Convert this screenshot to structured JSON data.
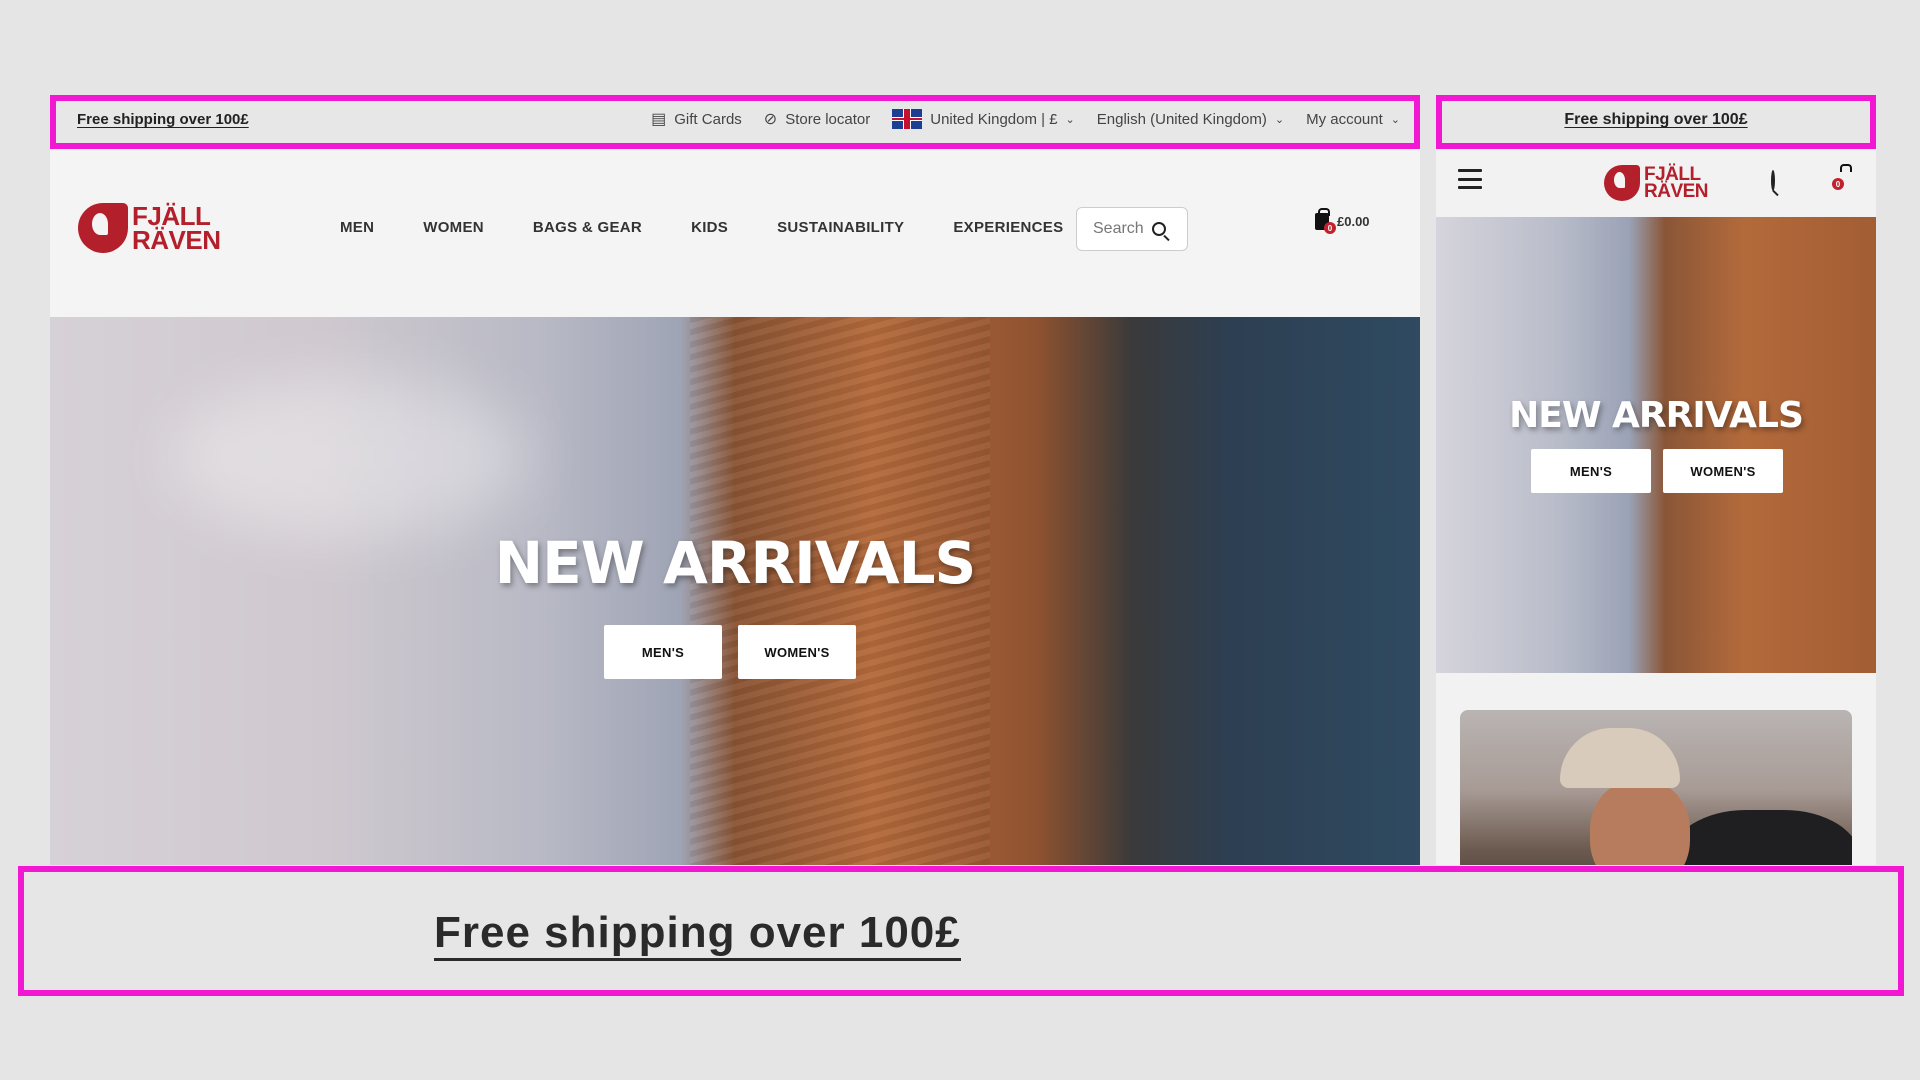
{
  "desktop": {
    "topbar": {
      "shipping": "Free shipping over 100£",
      "gift_cards": "Gift Cards",
      "store_locator": "Store locator",
      "country": "United Kingdom | £",
      "language": "English (United Kingdom)",
      "account": "My account"
    },
    "header": {
      "logo_line1": "FJÄLL",
      "logo_line2": "RÄVEN",
      "nav": [
        "MEN",
        "WOMEN",
        "BAGS & GEAR",
        "KIDS",
        "SUSTAINABILITY",
        "EXPERIENCES"
      ],
      "search_placeholder": "Search",
      "cart_count": "0",
      "cart_total": "£0.00"
    },
    "hero": {
      "title": "NEW ARRIVALS",
      "btn_mens": "MEN'S",
      "btn_womens": "WOMEN'S"
    }
  },
  "mobile": {
    "topbar": {
      "shipping": "Free shipping over 100£"
    },
    "header": {
      "logo_line1": "FJÄLL",
      "logo_line2": "RÄVEN",
      "cart_count": "0"
    },
    "hero": {
      "title": "NEW ARRIVALS",
      "btn_mens": "MEN'S",
      "btn_womens": "WOMEN'S"
    }
  },
  "zoom": {
    "text": "Free shipping over 100£"
  },
  "colors": {
    "highlight": "#f218d3",
    "brand": "#b3202c"
  }
}
